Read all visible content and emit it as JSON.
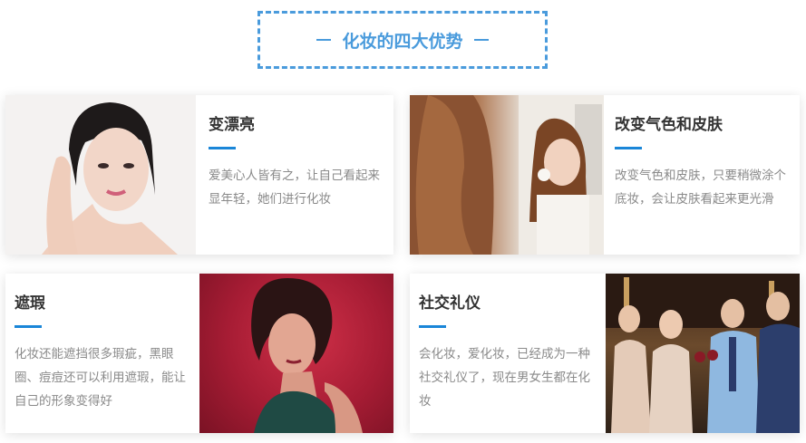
{
  "section": {
    "title": "化妆的四大优势"
  },
  "cards": [
    {
      "title": "变漂亮",
      "desc": "爱美心人皆有之，让自己看起来显年轻，她们进行化妆"
    },
    {
      "title": "改变气色和皮肤",
      "desc": "改变气色和皮肤，只要稍微涂个底妆，会让皮肤看起来更光滑"
    },
    {
      "title": "遮瑕",
      "desc": "化妆还能遮挡很多瑕疵，黑眼圈、痘痘还可以利用遮瑕，能让自己的形象变得好"
    },
    {
      "title": "社交礼仪",
      "desc": "会化妆，爱化妆，已经成为一种社交礼仪了，现在男女生都在化妆"
    }
  ],
  "colors": {
    "accent": "#4a9bdc",
    "bar": "#1a86d8",
    "title_text": "#333333",
    "body_text": "#8a8a8a"
  }
}
